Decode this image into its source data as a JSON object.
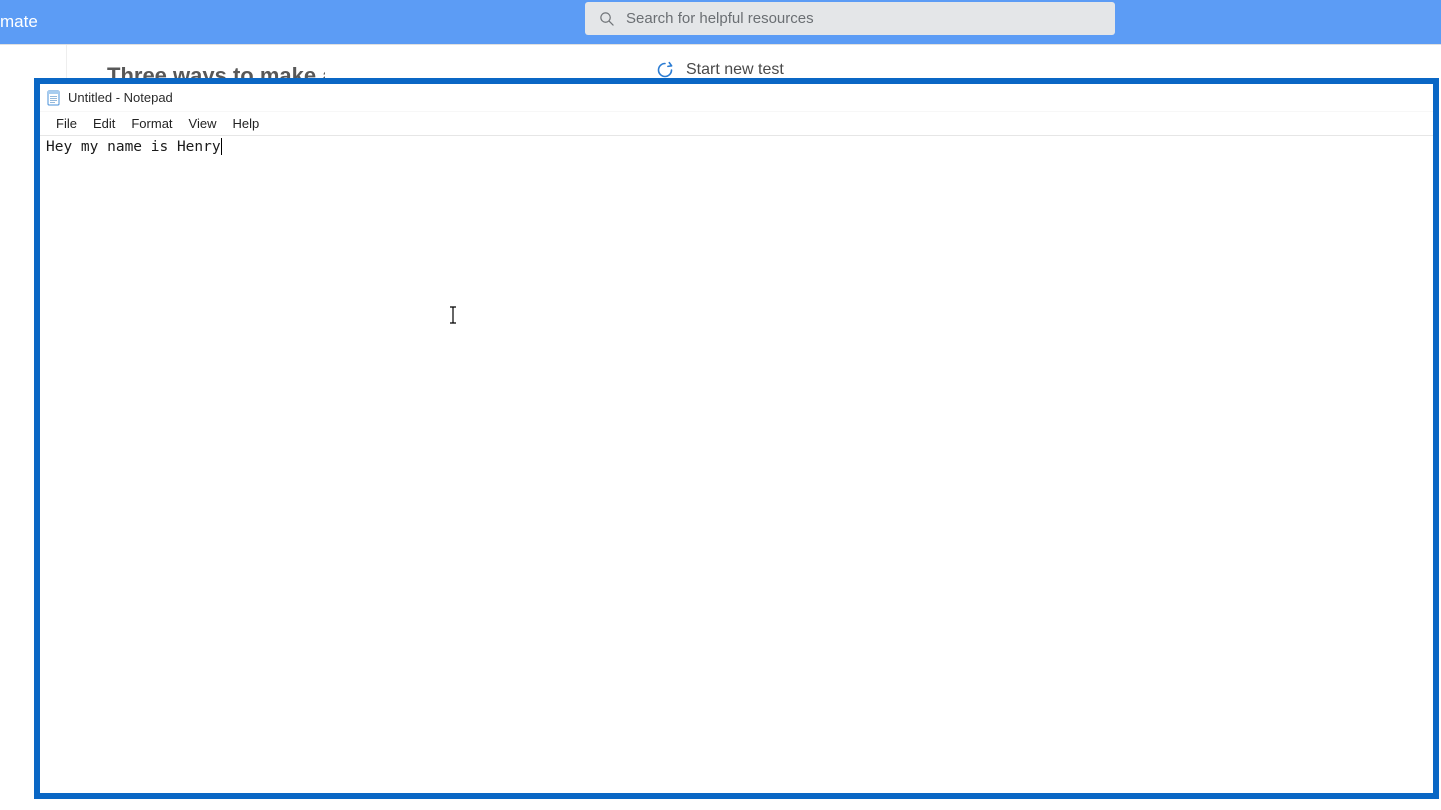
{
  "background": {
    "header_title_fragment": "mate",
    "search_placeholder": "Search for helpful resources",
    "heading_fragment": "Three ways to make a fl",
    "start_new_test_label": "Start new test"
  },
  "notepad": {
    "window_title": "Untitled - Notepad",
    "menu": {
      "file": "File",
      "edit": "Edit",
      "format": "Format",
      "view": "View",
      "help": "Help"
    },
    "content": "Hey my name is Henry"
  }
}
